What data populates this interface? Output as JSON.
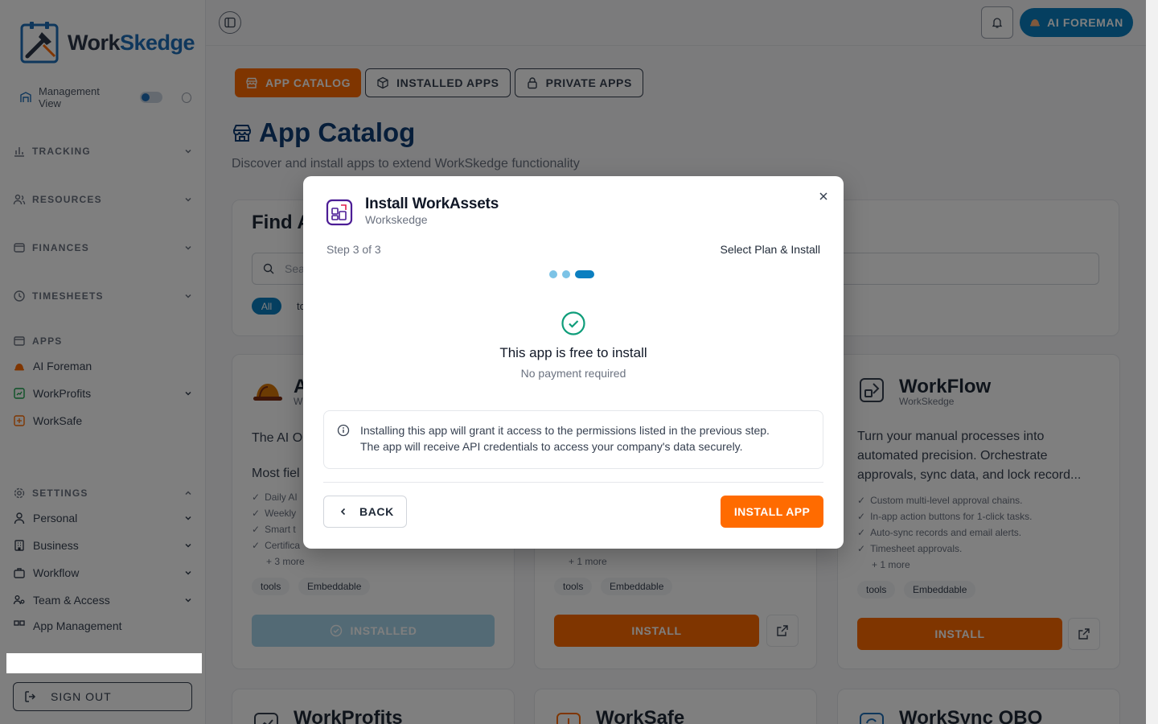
{
  "brand": {
    "name_part1": "Work",
    "name_part2": "Skedge",
    "accent": "#1e6fb8",
    "orange": "#ff6b00"
  },
  "sidebar": {
    "management_view_label": "Management View",
    "sections": [
      {
        "label": "TRACKING",
        "icon": "bar-chart-icon"
      },
      {
        "label": "RESOURCES",
        "icon": "users-icon"
      },
      {
        "label": "FINANCES",
        "icon": "wallet-icon"
      },
      {
        "label": "TIMESHEETS",
        "icon": "clock-icon"
      }
    ],
    "apps_section": {
      "label": "APPS",
      "items": [
        {
          "label": "AI Foreman",
          "icon": "foreman-hat-icon"
        },
        {
          "label": "WorkProfits",
          "icon": "workprofits-icon"
        },
        {
          "label": "WorkSafe",
          "icon": "worksafe-icon"
        }
      ]
    },
    "settings_section": {
      "label": "SETTINGS",
      "items": [
        {
          "label": "Personal",
          "icon": "user-icon"
        },
        {
          "label": "Business",
          "icon": "building-icon"
        },
        {
          "label": "Workflow",
          "icon": "briefcase-icon"
        },
        {
          "label": "Team & Access",
          "icon": "team-icon"
        },
        {
          "label": "App Management",
          "icon": "app-management-icon"
        }
      ]
    },
    "sign_out_label": "SIGN OUT"
  },
  "topbar": {
    "ai_foreman_label": "AI FOREMAN"
  },
  "tabs": [
    {
      "label": "APP CATALOG",
      "active": true
    },
    {
      "label": "INSTALLED APPS",
      "active": false
    },
    {
      "label": "PRIVATE APPS",
      "active": false
    }
  ],
  "page": {
    "title": "App Catalog",
    "subtitle": "Discover and install apps to extend WorkSkedge functionality",
    "find_title": "Find A",
    "search_placeholder": "Sea",
    "chip_all": "All",
    "chip_partial": "to"
  },
  "cards": [
    {
      "title": "A",
      "by": "W",
      "desc": "The AI O",
      "desc2": "Most fiel",
      "features": [
        "Daily AI",
        "Weekly",
        "Smart t",
        "Certifica"
      ],
      "more": "+ 3 more",
      "tags": [
        "tools",
        "Embeddable"
      ],
      "button": "INSTALLED"
    },
    {
      "more": "+ 1 more",
      "tags": [
        "tools",
        "Embeddable"
      ],
      "button": "INSTALL"
    },
    {
      "title": "WorkFlow",
      "by": "WorkSkedge",
      "desc": "Turn your manual processes into automated precision. Orchestrate approvals, sync data, and lock record...",
      "features": [
        "Custom multi-level approval chains.",
        "In-app action buttons for 1-click tasks.",
        "Auto-sync records and email alerts.",
        "Timesheet approvals."
      ],
      "more": "+ 1 more",
      "tags": [
        "tools",
        "Embeddable"
      ],
      "button": "INSTALL"
    }
  ],
  "bottom_cards": [
    {
      "title": "WorkProfits"
    },
    {
      "title": "WorkSafe"
    },
    {
      "title": "WorkSync QBO"
    }
  ],
  "modal": {
    "title": "Install WorkAssets",
    "subtitle": "Workskedge",
    "step": "Step 3 of 3",
    "step_label": "Select Plan & Install",
    "free_title": "This app is free to install",
    "free_sub": "No payment required",
    "notice_line1": "Installing this app will grant it access to the permissions listed in the previous step.",
    "notice_line2": "The app will receive API credentials to access your company's data securely.",
    "back_label": "BACK",
    "install_label": "INSTALL APP"
  }
}
